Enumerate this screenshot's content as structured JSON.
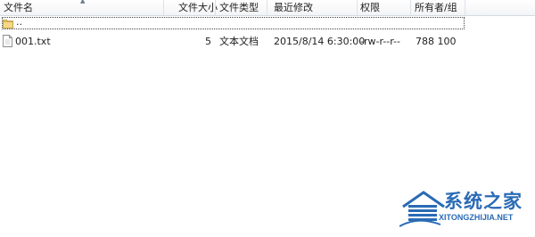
{
  "columns": {
    "name": "文件名",
    "size": "文件大小",
    "type": "文件类型",
    "modified": "最近修改",
    "permissions": "权限",
    "owner_group": "所有者/组"
  },
  "rows": [
    {
      "name": "..",
      "icon": "folder-icon"
    },
    {
      "name": "001.txt",
      "icon": "text-file-icon",
      "size": "5",
      "type": "文本文档",
      "modified": "2015/8/14 6:30:00",
      "permissions": "-rw-r--r--",
      "owner_group": "788 100"
    }
  ],
  "watermark": {
    "title": "系统之家",
    "subtitle": "XITONGZHIJIA.NET",
    "color": "#2a6bb5"
  }
}
